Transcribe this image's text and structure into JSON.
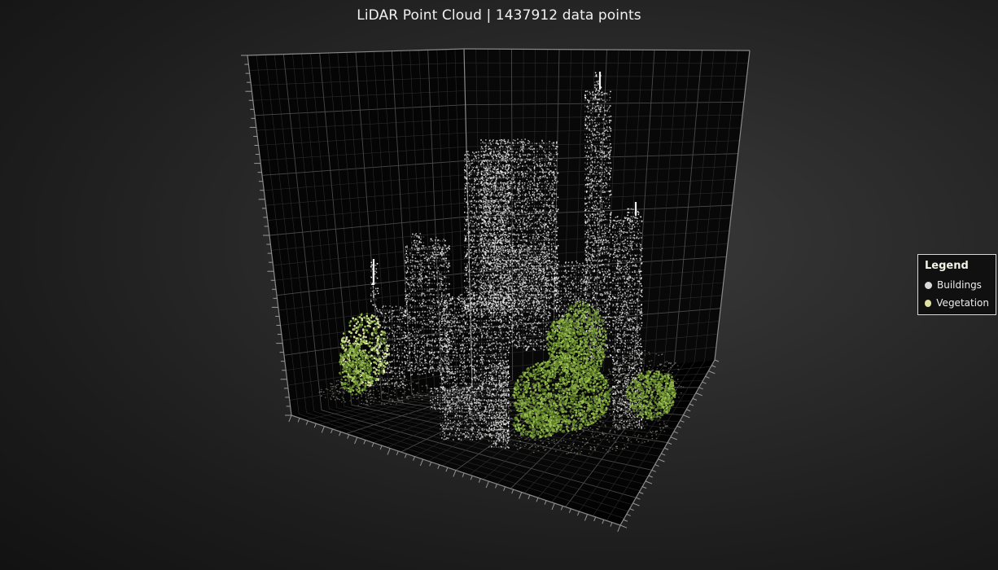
{
  "title": "LiDAR Point Cloud | 1437912 data points",
  "legend": {
    "title": "Legend",
    "items": [
      {
        "label": "Buildings",
        "color": "#d9d9d9"
      },
      {
        "label": "Vegetation",
        "color": "#e0e0a4"
      }
    ]
  },
  "chart_data": {
    "type": "scatter",
    "subtype": "3d-point-cloud",
    "title": "LiDAR Point Cloud | 1437912 data points",
    "point_count": 1437912,
    "series": [
      {
        "name": "Buildings",
        "color": "#f0f0f0"
      },
      {
        "name": "Vegetation",
        "color": "#7a9a3e"
      }
    ],
    "grid": true,
    "axis_labels_visible": false,
    "legend_position": "right",
    "background": "#222222"
  }
}
